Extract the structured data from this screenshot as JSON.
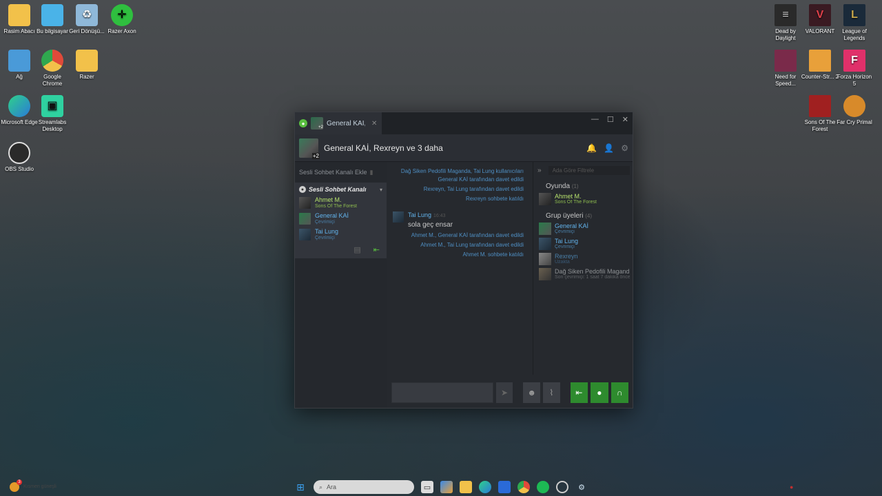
{
  "desktop_left": [
    {
      "label": "Rasim Abacı",
      "icon": "folder-icon",
      "color": "#f2c14a"
    },
    {
      "label": "Bu bilgisayar",
      "icon": "computer-icon",
      "color": "#4ab3e8"
    },
    {
      "label": "Geri Dönüşü...",
      "icon": "recycle-bin-icon",
      "color": "#8fb8d8"
    },
    {
      "label": "Razer Axon",
      "icon": "razer-axon-icon",
      "color": "#2fbf3f"
    },
    {
      "label": "Ağ",
      "icon": "network-icon",
      "color": "#4a9ad8"
    },
    {
      "label": "Google Chrome",
      "icon": "chrome-icon",
      "color": "#e04a3a"
    },
    {
      "label": "Razer",
      "icon": "razer-folder-icon",
      "color": "#f2c14a"
    },
    {
      "label": "Microsoft Edge",
      "icon": "edge-icon",
      "color": "#2aa8d8"
    },
    {
      "label": "Streamlabs Desktop",
      "icon": "streamlabs-icon",
      "color": "#2fd1a0"
    },
    {
      "label": "OBS Studio",
      "icon": "obs-icon",
      "color": "#2a2a2a"
    }
  ],
  "desktop_right": [
    {
      "label": "Dead by Daylight",
      "icon": "dead-by-daylight-icon",
      "color": "#2a2a2a"
    },
    {
      "label": "VALORANT",
      "icon": "valorant-icon",
      "color": "#e0404a"
    },
    {
      "label": "League of Legends",
      "icon": "league-of-legends-icon",
      "color": "#c8a84a"
    },
    {
      "label": "Need for Speed...",
      "icon": "need-for-speed-icon",
      "color": "#7a2a4a"
    },
    {
      "label": "Counter-Str... 2",
      "icon": "counter-strike-icon",
      "color": "#e8a03a"
    },
    {
      "label": "Forza Horizon 5",
      "icon": "forza-icon",
      "color": "#e0306a"
    },
    {
      "label": "Sons Of The Forest",
      "icon": "sons-of-the-forest-icon",
      "color": "#a02020"
    },
    {
      "label": "Far Cry Primal",
      "icon": "far-cry-icon",
      "color": "#d88a2a"
    }
  ],
  "chat": {
    "tab_label": "General KAİ, Rexreyn",
    "title": "General KAİ, Rexreyn ve 3 daha",
    "avatar_plus": "+2",
    "add_voice_label": "Sesli Sohbet Kanalı Ekle",
    "voice_channel_label": "Sesli Sohbet Kanalı",
    "voice_members": [
      {
        "name": "Ahmet M.",
        "status": "Sons Of The Forest",
        "kind": "ingame"
      },
      {
        "name": "General KAİ",
        "status": "Çevrimiçi",
        "kind": "online"
      },
      {
        "name": "Tai Lung",
        "status": "Çevrimiçi",
        "kind": "online"
      }
    ],
    "system_messages_top": [
      "Dağ Siken Pedofili Maganda, Tai Lung kullanıcıları General KAİ tarafından davet edildi",
      "Rexreyn, Tai Lung tarafından davet edildi",
      "Rexreyn sohbete katıldı"
    ],
    "message": {
      "author": "Tai Lung",
      "time": "16:43",
      "text": "sola geç ensar"
    },
    "system_messages_bottom": [
      "Ahmet M., General KAİ tarafından davet edildi",
      "Ahmet M., Tai Lung tarafından davet edildi",
      "Ahmet M. sohbete katıldı"
    ],
    "filter_placeholder": "Ada Göre Filtrele",
    "in_game_title": "Oyunda",
    "in_game_count": "(1)",
    "in_game_members": [
      {
        "name": "Ahmet M.",
        "status": "Sons Of The Forest"
      }
    ],
    "group_title": "Grup üyeleri",
    "group_count": "(4)",
    "group_members": [
      {
        "name": "General KAİ",
        "status": "Çevrimiçi",
        "kind": "online"
      },
      {
        "name": "Tai Lung",
        "status": "Çevrimiçi",
        "kind": "online"
      },
      {
        "name": "Rexreyn",
        "status": "Uzakta",
        "kind": "away"
      },
      {
        "name": "Dağ Siken Pedofili Maganda",
        "status": "Son çevrimiçi: 1 saat 7 dakika önce",
        "kind": "offline"
      }
    ]
  },
  "taskbar": {
    "search_placeholder": "Ara",
    "weather_badge": "3",
    "weather_text": "Kısmen güneşli",
    "items": [
      "windows-start-icon",
      "search-icon",
      "task-view-icon",
      "copilot-icon",
      "file-explorer-icon",
      "edge-icon",
      "store-icon",
      "chrome-icon",
      "spotify-icon",
      "razer-icon",
      "steam-icon"
    ]
  }
}
